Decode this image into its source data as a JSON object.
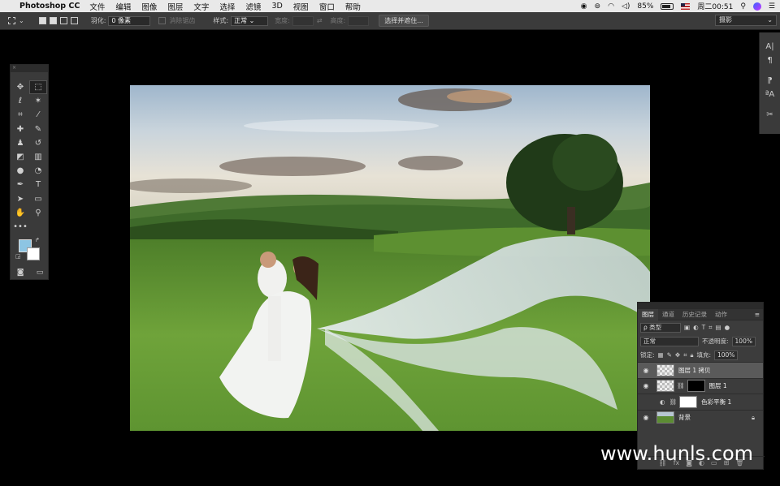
{
  "menubar": {
    "app_name": "Photoshop CC",
    "items": [
      "文件",
      "编辑",
      "图像",
      "图层",
      "文字",
      "选择",
      "滤镜",
      "3D",
      "视图",
      "窗口",
      "帮助"
    ],
    "battery": "85%",
    "clock": "周二00:51"
  },
  "options": {
    "feather_label": "羽化:",
    "feather_value": "0 像素",
    "antialias_label": "消除锯齿",
    "style_label": "样式:",
    "style_value": "正常",
    "width_label": "宽度:",
    "height_label": "高度:",
    "select_mask_button": "选择并遮住...",
    "workspace": "摄影"
  },
  "tools": {
    "rows": [
      [
        "move-icon",
        "marquee-icon"
      ],
      [
        "lasso-icon",
        "magic-wand-icon"
      ],
      [
        "crop-icon",
        "eyedropper-icon"
      ],
      [
        "healing-brush-icon",
        "brush-icon"
      ],
      [
        "clone-stamp-icon",
        "history-brush-icon"
      ],
      [
        "eraser-icon",
        "gradient-icon"
      ],
      [
        "blur-icon",
        "dodge-icon"
      ],
      [
        "pen-icon",
        "type-icon"
      ],
      [
        "path-selection-icon",
        "rectangle-icon"
      ],
      [
        "hand-icon",
        "zoom-icon"
      ],
      [
        "more-tools-icon",
        ""
      ]
    ],
    "glyphs": {
      "move-icon": "✥",
      "marquee-icon": "⬚",
      "lasso-icon": "ℓ",
      "magic-wand-icon": "✶",
      "crop-icon": "⌗",
      "eyedropper-icon": "⁄",
      "healing-brush-icon": "✚",
      "brush-icon": "✎",
      "clone-stamp-icon": "♟",
      "history-brush-icon": "↺",
      "eraser-icon": "◩",
      "gradient-icon": "▥",
      "blur-icon": "●",
      "dodge-icon": "◔",
      "pen-icon": "✒",
      "type-icon": "T",
      "path-selection-icon": "➤",
      "rectangle-icon": "▭",
      "hand-icon": "✋",
      "zoom-icon": "⚲",
      "more-tools-icon": "•••"
    },
    "foreground_color": "#8dc5e3",
    "background_color": "#ffffff"
  },
  "layers_panel": {
    "tabs": [
      "图层",
      "通道",
      "历史记录",
      "动作"
    ],
    "filter_kind": "ρ 类型",
    "blend_mode": "正常",
    "opacity_label": "不透明度:",
    "opacity_value": "100%",
    "lock_label": "锁定:",
    "fill_label": "填充:",
    "fill_value": "100%",
    "layers": [
      {
        "name": "图层 1 拷贝",
        "visible": true,
        "selected": true
      },
      {
        "name": "图层 1",
        "visible": true,
        "selected": false
      },
      {
        "name": "色彩平衡 1",
        "visible": false,
        "selected": false
      },
      {
        "name": "背景",
        "visible": true,
        "selected": false
      }
    ]
  },
  "watermark": "www.hunls.com"
}
